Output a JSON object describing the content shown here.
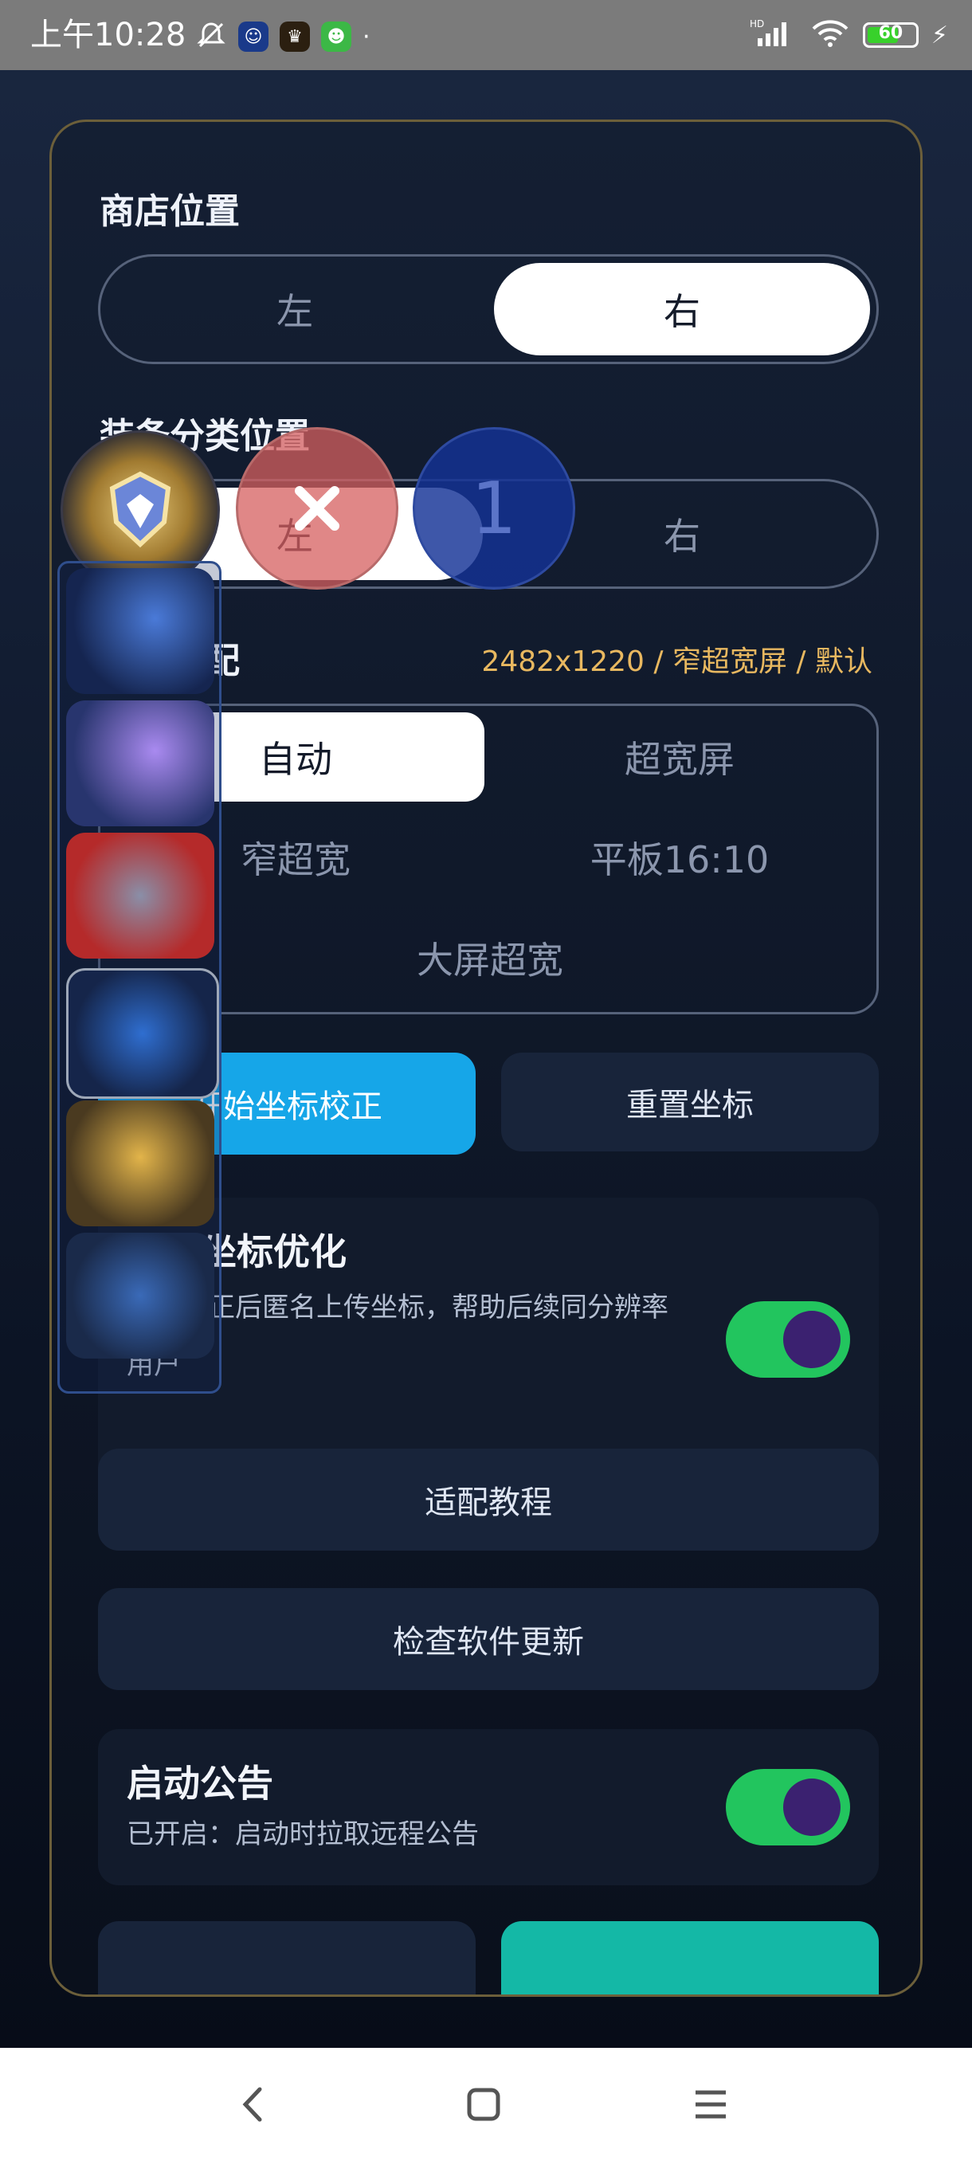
{
  "status_bar": {
    "time": "上午10:28",
    "battery": "60",
    "battery_level": 0.6
  },
  "store_position": {
    "label": "商店位置",
    "options": [
      "左",
      "右"
    ],
    "selected": "右"
  },
  "equipment_position": {
    "label": "装备分类位置",
    "options": [
      "左",
      "右"
    ],
    "selected": "左"
  },
  "coordinate_adapt": {
    "label": "坐标适配",
    "resolution_info": "2482x1220 / 窄超宽屏 / 默认",
    "options": [
      "自动",
      "超宽屏",
      "窄超宽",
      "平板16:10",
      "大屏超宽"
    ],
    "selected": "自动"
  },
  "buttons": {
    "start_calibration": "开始坐标校正",
    "reset_coords": "重置坐标",
    "tutorial": "适配教程",
    "check_update": "检查软件更新"
  },
  "coord_optimize": {
    "title": "参与坐标优化",
    "description_line1": "保存校正后匿名上传坐标，帮助后续同分辨率",
    "description_line2": "用户",
    "enabled": true
  },
  "startup_notice": {
    "title": "启动公告",
    "description": "已开启：启动时拉取远程公告",
    "enabled": true
  },
  "overlay": {
    "badge_number": "1"
  },
  "colors": {
    "accent_blue": "#16a6e8",
    "toggle_green": "#22c55e",
    "resolution_text": "#e8b860",
    "bottom_teal": "#14b8a6"
  }
}
